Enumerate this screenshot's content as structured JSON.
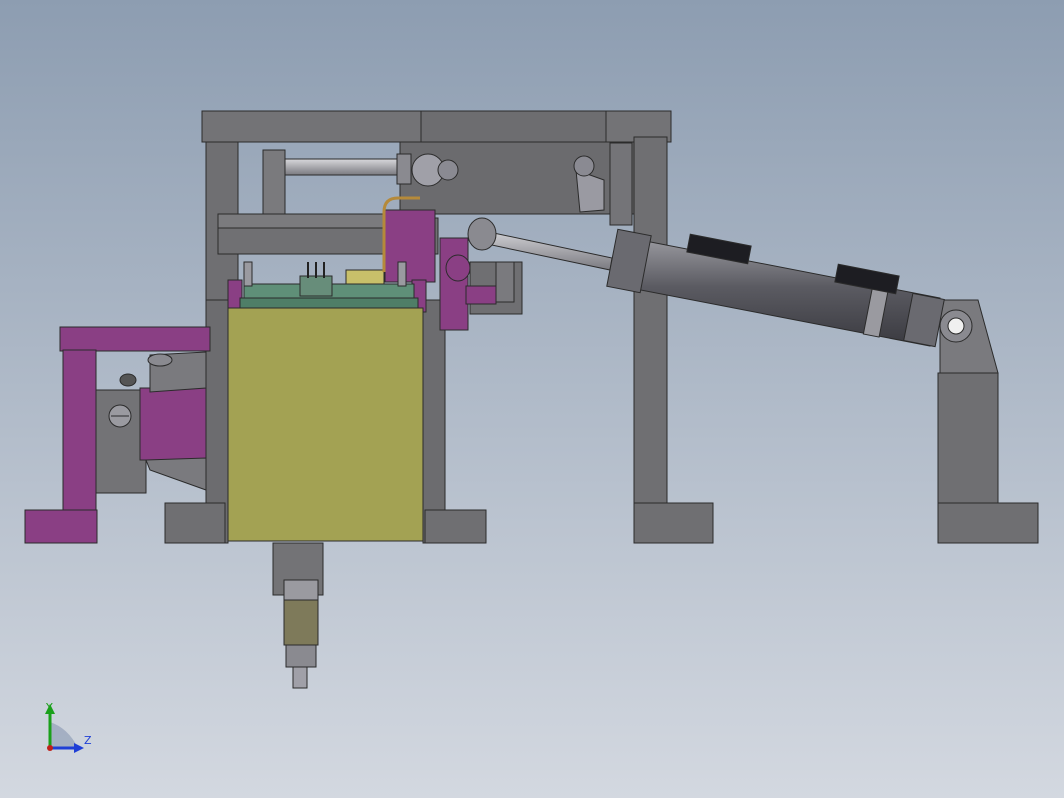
{
  "viewport": {
    "background_top": "#8d9db1",
    "background_bottom": "#d3d8e0"
  },
  "colors": {
    "frame_gray": "#6f6f72",
    "frame_gray_light": "#7c7c80",
    "frame_edge": "#2b2b2b",
    "purple": "#8a3f84",
    "olive": "#a3a253",
    "pcb_green": "#5f8f78",
    "cylinder_dark": "#4c4c52",
    "cylinder_light": "#8a8a90",
    "axis_y": "#1aa01a",
    "axis_z": "#1f3fd6",
    "axis_origin": "#c0201a"
  },
  "triad": {
    "y_label": "Y",
    "z_label": "Z"
  }
}
